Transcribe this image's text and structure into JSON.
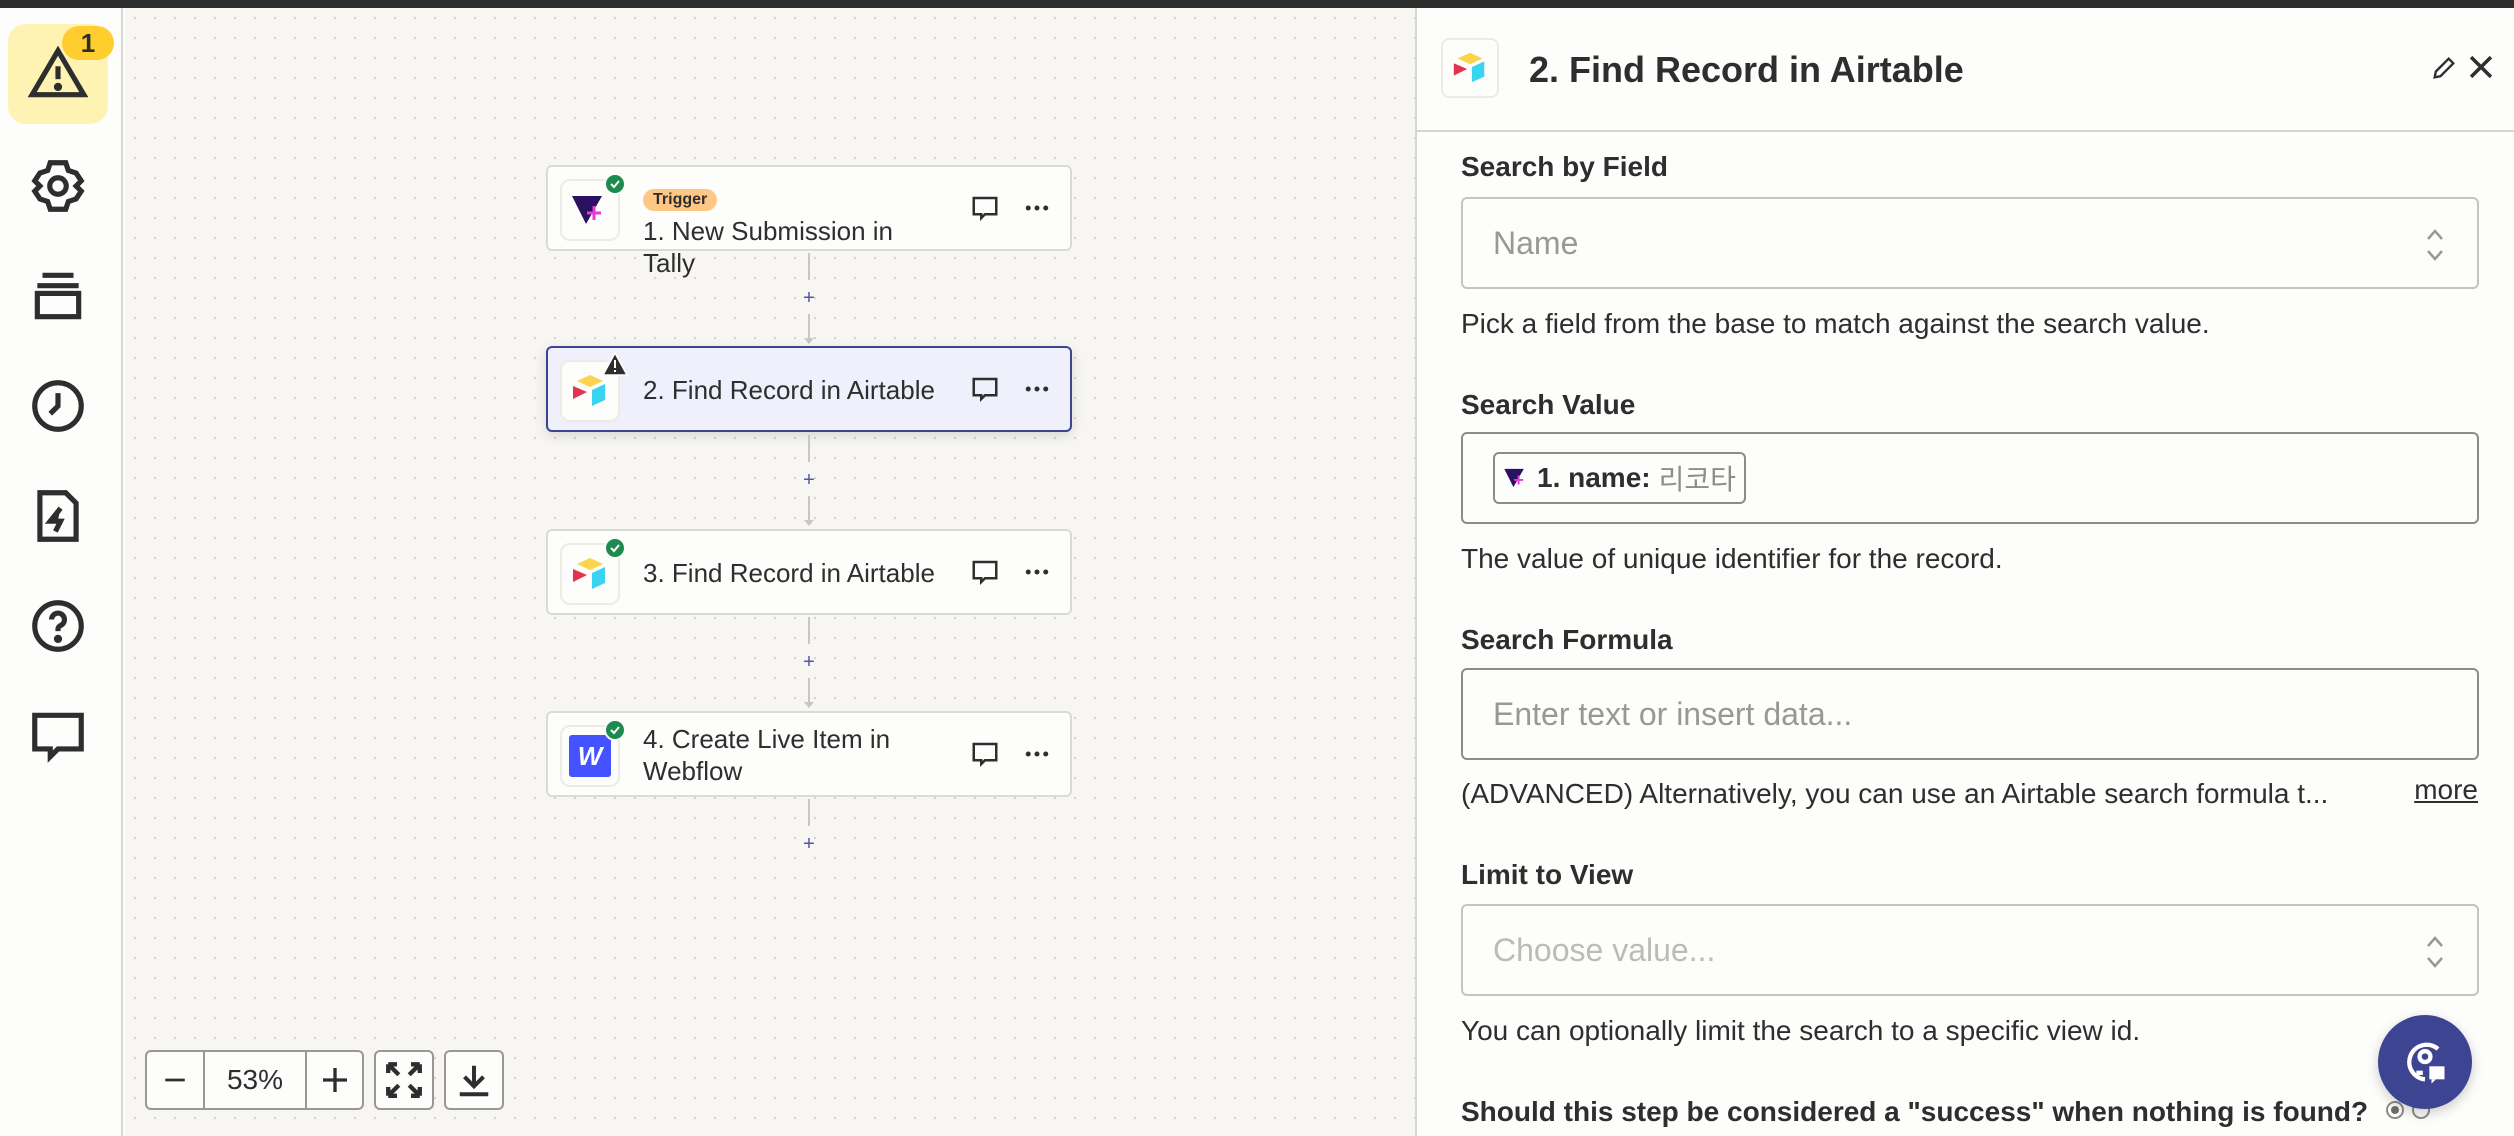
{
  "sidebar": {
    "items": [
      {
        "name": "alerts",
        "icon": "warning-icon",
        "badge": "1",
        "active": true
      },
      {
        "name": "settings",
        "icon": "gear-icon"
      },
      {
        "name": "versions",
        "icon": "stack-icon"
      },
      {
        "name": "history",
        "icon": "clock-icon"
      },
      {
        "name": "zap-runs",
        "icon": "file-bolt-icon"
      },
      {
        "name": "help",
        "icon": "question-icon"
      },
      {
        "name": "comments",
        "icon": "comment-icon"
      }
    ]
  },
  "canvas": {
    "steps": [
      {
        "tag": "Trigger",
        "title": "1. New Submission in Tally",
        "app": "Tally",
        "status": "ok"
      },
      {
        "title": "2. Find Record in Airtable",
        "app": "Airtable",
        "status": "warning",
        "selected": true
      },
      {
        "title": "3. Find Record in Airtable",
        "app": "Airtable",
        "status": "ok"
      },
      {
        "title": "4. Create Live Item in Webflow",
        "app": "Webflow",
        "status": "ok"
      }
    ],
    "add_step_symbol": "+",
    "zoom": {
      "minus": "−",
      "level": "53%",
      "plus": "+"
    }
  },
  "panel": {
    "title": "2. Find Record in Airtable",
    "fields": {
      "search_by_field": {
        "label": "Search by Field",
        "value": "Name",
        "help": "Pick a field from the base to match against the search value."
      },
      "search_value": {
        "label": "Search Value",
        "pill_label": "1. name:",
        "pill_value": "리코타",
        "help": "The value of unique identifier for the record."
      },
      "search_formula": {
        "label": "Search Formula",
        "placeholder": "Enter text or insert data...",
        "help": "(ADVANCED) Alternatively, you can use an Airtable search formula t...",
        "more": "more"
      },
      "limit_to_view": {
        "label": "Limit to View",
        "placeholder": "Choose value...",
        "help": "You can optionally limit the search to a specific view id."
      },
      "success_when_nothing_found": {
        "label": "Should this step be considered a \"success\" when nothing is found?",
        "selected": "first"
      }
    }
  },
  "colors": {
    "accent": "#3d4592",
    "warning": "#ffcd2e",
    "success": "#1d8a4e",
    "trigger_tag": "#ffc785"
  }
}
